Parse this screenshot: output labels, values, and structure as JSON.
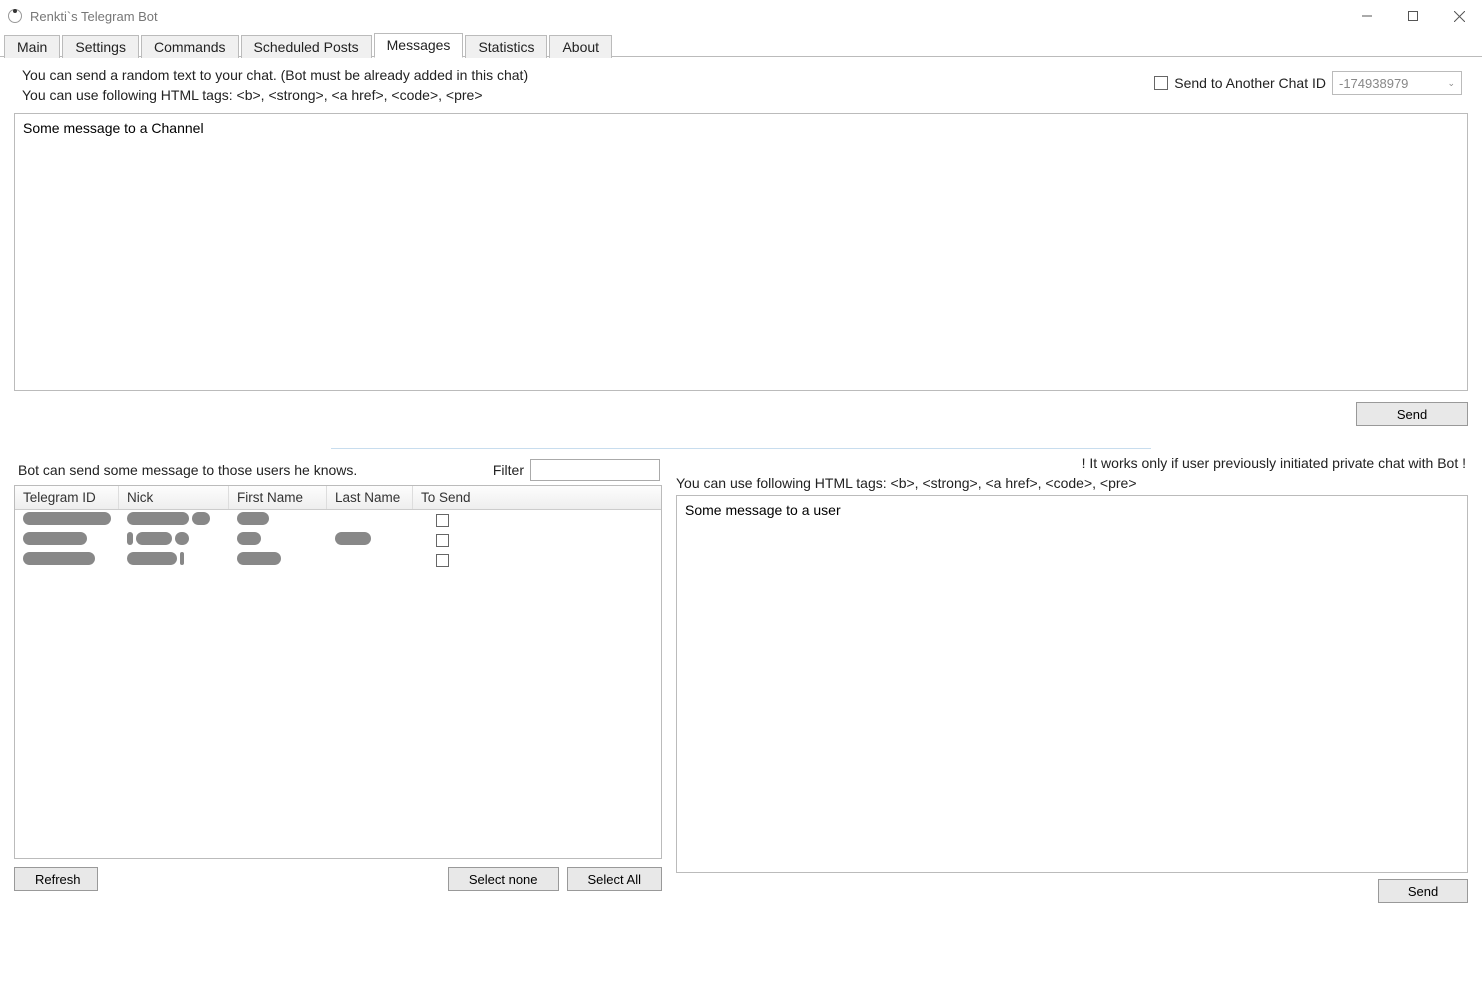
{
  "window": {
    "title": "Renkti`s Telegram Bot"
  },
  "tabs": {
    "items": [
      "Main",
      "Settings",
      "Commands",
      "Scheduled Posts",
      "Messages",
      "Statistics",
      "About"
    ],
    "active_index": 4
  },
  "top": {
    "info_line1": "You can send a random text to your chat.   (Bot must be already added in this chat)",
    "info_line2": "You can use following HTML tags:   <b>, <strong>, <a href>, <code>, <pre>",
    "send_another_label": "Send to Another Chat ID",
    "chat_id_value": "-174938979",
    "message_text": "Some message to a Channel",
    "send_button": "Send"
  },
  "lower_left": {
    "info": "Bot can send some message to those users he knows.",
    "filter_label": "Filter",
    "headers": {
      "id": "Telegram ID",
      "nick": "Nick",
      "first": "First Name",
      "last": "Last Name",
      "send": "To Send"
    },
    "rows": [
      {
        "id": "████████",
        "nick": "Ak███████",
        "first": "N███",
        "last": "",
        "checked": false
      },
      {
        "id": "██████",
        "nick": "i████ng",
        "first": "E██",
        "last": "King█",
        "checked": false
      },
      {
        "id": "███████",
        "nick": "R█N███",
        "first": "██████",
        "last": "",
        "checked": false
      }
    ],
    "refresh": "Refresh",
    "select_none": "Select none",
    "select_all": "Select All"
  },
  "lower_right": {
    "notice": "! It works only if user previously initiated private chat with Bot !",
    "tags_info": "You can use following HTML tags:   <b>, <strong>, <a href>, <code>, <pre>",
    "message_text": "Some message to a user",
    "send_button": "Send"
  }
}
